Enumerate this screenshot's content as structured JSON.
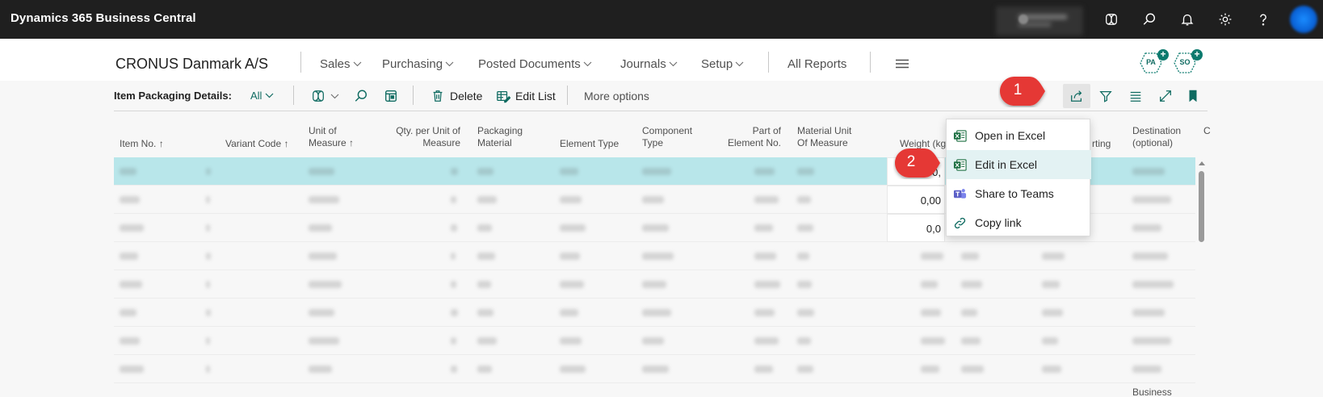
{
  "app": {
    "title": "Dynamics 365 Business Central"
  },
  "nav": {
    "company": "CRONUS Danmark A/S",
    "menus": [
      "Sales",
      "Purchasing",
      "Posted Documents",
      "Journals",
      "Setup"
    ],
    "all_reports": "All Reports",
    "badges": [
      "PA",
      "SO"
    ]
  },
  "actionbar": {
    "page_caption": "Item Packaging Details:",
    "filter": "All",
    "delete": "Delete",
    "edit_list": "Edit List",
    "more_options": "More options"
  },
  "grid": {
    "headers": {
      "item_no": "Item No.",
      "variant_code": "Variant Code",
      "unit_of_measure_1": "Unit of",
      "unit_of_measure_2": "Measure",
      "qty_per_unit_1": "Qty. per Unit of",
      "qty_per_unit_2": "Measure",
      "packaging_material_1": "Packaging",
      "packaging_material_2": "Material",
      "element_type": "Element Type",
      "component_type_1": "Component",
      "component_type_2": "Type",
      "part_of_element_1": "Part of",
      "part_of_element_2": "Element No.",
      "material_unit_1": "Material Unit",
      "material_unit_2": "Of Measure",
      "weight": "Weight (kg",
      "reporting": "rting",
      "destination_1": "Destination",
      "destination_2": "(optional)",
      "extra": "C"
    },
    "sort_arrow": "↑",
    "row_count": 8,
    "selected_row_index": 0,
    "visible_weights": [
      "0,",
      "0,00",
      "0,0"
    ],
    "bottom_partial_text": "Business"
  },
  "menu": {
    "items": [
      {
        "label": "Open in Excel",
        "icon": "excel-icon"
      },
      {
        "label": "Edit in Excel",
        "icon": "excel-icon"
      },
      {
        "label": "Share to Teams",
        "icon": "teams-icon"
      },
      {
        "label": "Copy link",
        "icon": "link-icon"
      }
    ],
    "highlighted_index": 1
  },
  "callouts": [
    "1",
    "2"
  ],
  "colors": {
    "topbar": "#1f1f1f",
    "accent": "#0f6b61",
    "selected_row": "#b8e6ea",
    "callout": "#e53935",
    "excel_green": "#1d6f42",
    "teams_purple": "#5b5fc7"
  }
}
